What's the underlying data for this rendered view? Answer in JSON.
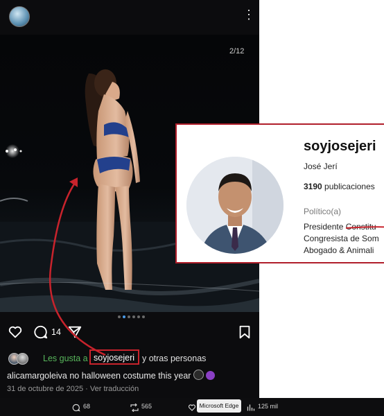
{
  "post": {
    "image_counter": "2/12",
    "comment_count": "14",
    "liked_by_prefix": "Les gusta a",
    "liked_by_user": "soyjosejeri",
    "liked_by_suffix": "y otras personas",
    "caption_user": "alicamargoleiva",
    "caption_text": "no halloween costume this year",
    "date": "31 de octubre de 2025",
    "separator": "·",
    "translate_link": "Ver traducción"
  },
  "profile": {
    "username": "soyjosejeri",
    "full_name": "José Jerí",
    "posts_count": "3190",
    "posts_label": "publicaciones",
    "category": "Político(a)",
    "bio_line1_prefix": "Presidente ",
    "bio_line1_struck": "Constitu",
    "bio_line2": "Congresista de Som",
    "bio_line3": "Abogado & Animali"
  },
  "bottom_bar": {
    "replies": "68",
    "reposts": "565",
    "views": "125 mil",
    "tooltip": "Microsoft Edge"
  },
  "colors": {
    "highlight_red": "#c8232c",
    "liked_green": "#58b65b"
  },
  "icons": [
    "kebab-menu-icon",
    "heart-icon",
    "comment-icon",
    "share-icon",
    "bookmark-icon",
    "reply-icon",
    "repost-icon",
    "views-icon"
  ]
}
